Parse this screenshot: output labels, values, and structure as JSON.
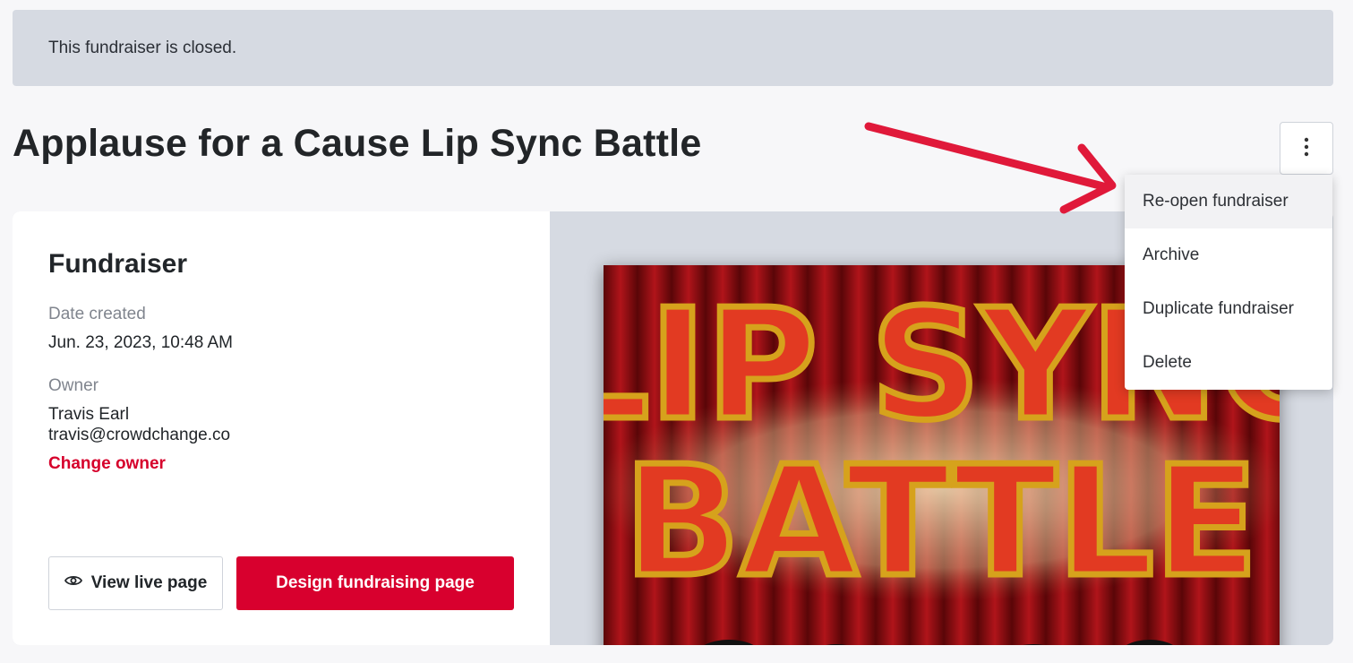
{
  "banner": {
    "text": "This fundraiser is closed."
  },
  "page": {
    "title": "Applause for a Cause Lip Sync Battle"
  },
  "actions_menu": {
    "toggle_icon": "kebab-vertical-icon",
    "items": [
      {
        "label": "Re-open fundraiser"
      },
      {
        "label": "Archive"
      },
      {
        "label": "Duplicate fundraiser"
      },
      {
        "label": "Delete"
      }
    ]
  },
  "fundraiser": {
    "section_title": "Fundraiser",
    "date_created_label": "Date created",
    "date_created_value": "Jun. 23, 2023, 10:48 AM",
    "owner_label": "Owner",
    "owner_name": "Travis Earl",
    "owner_email": "travis@crowdchange.co",
    "change_owner_label": "Change owner"
  },
  "buttons": {
    "view_live": "View live page",
    "view_live_icon": "eye-icon",
    "design_page": "Design fundraising page"
  },
  "poster": {
    "line1": "LIP SYNC",
    "line2": "BATTLE"
  },
  "colors": {
    "brand_red": "#d8002e",
    "annotation_arrow": "#e0193a",
    "banner_bg": "#d6dae2"
  }
}
